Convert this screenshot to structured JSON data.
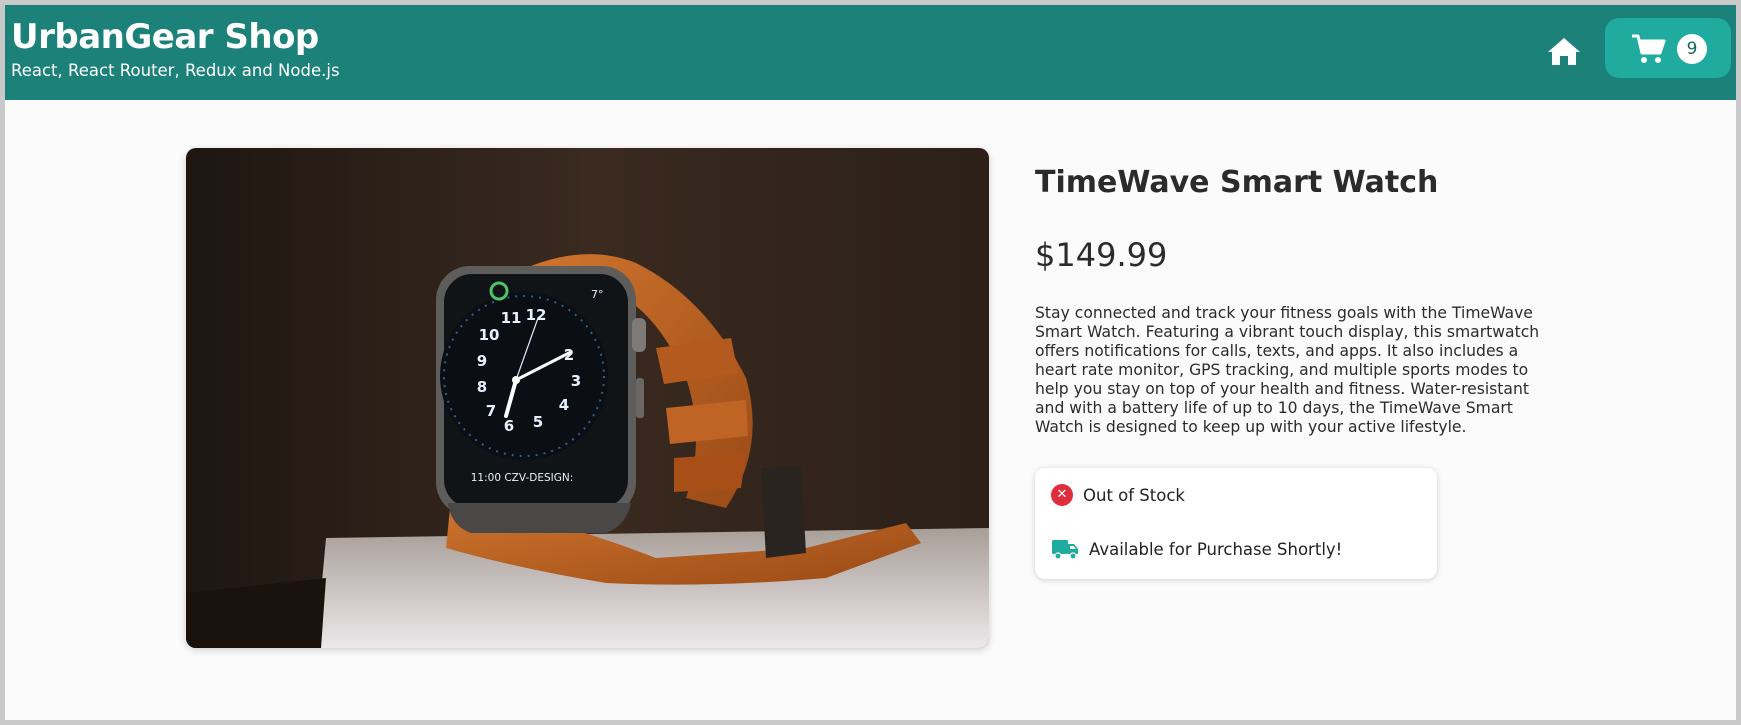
{
  "header": {
    "brand_title": "UrbanGear Shop",
    "brand_subtitle": "React, React Router, Redux and Node.js",
    "home_icon": "home-icon",
    "cart_icon": "shopping-cart-icon",
    "cart_count": "9",
    "background_color": "#1b8179",
    "cart_button_color": "#1fab9e"
  },
  "product": {
    "title": "TimeWave Smart Watch",
    "price": "$149.99",
    "description": "Stay connected and track your fitness goals with the TimeWave Smart Watch. Featuring a vibrant touch display, this smartwatch offers notifications for calls, texts, and apps. It also includes a heart rate monitor, GPS tracking, and multiple sports modes to help you stay on top of your health and fitness. Water-resistant and with a battery life of up to 10 days, the TimeWave Smart Watch is designed to keep up with your active lifestyle.",
    "image_alt": "smartwatch with brown leather strap",
    "watch_face_text": "11:00 CZV-DESIGN:",
    "watch_corner_text": "7°"
  },
  "stock": {
    "status_label": "Out of Stock",
    "status_icon": "close-circle-icon",
    "status_color": "#e02d3c",
    "availability_label": "Available for Purchase Shortly!",
    "availability_icon": "truck-icon",
    "availability_color": "#1fab9e"
  }
}
